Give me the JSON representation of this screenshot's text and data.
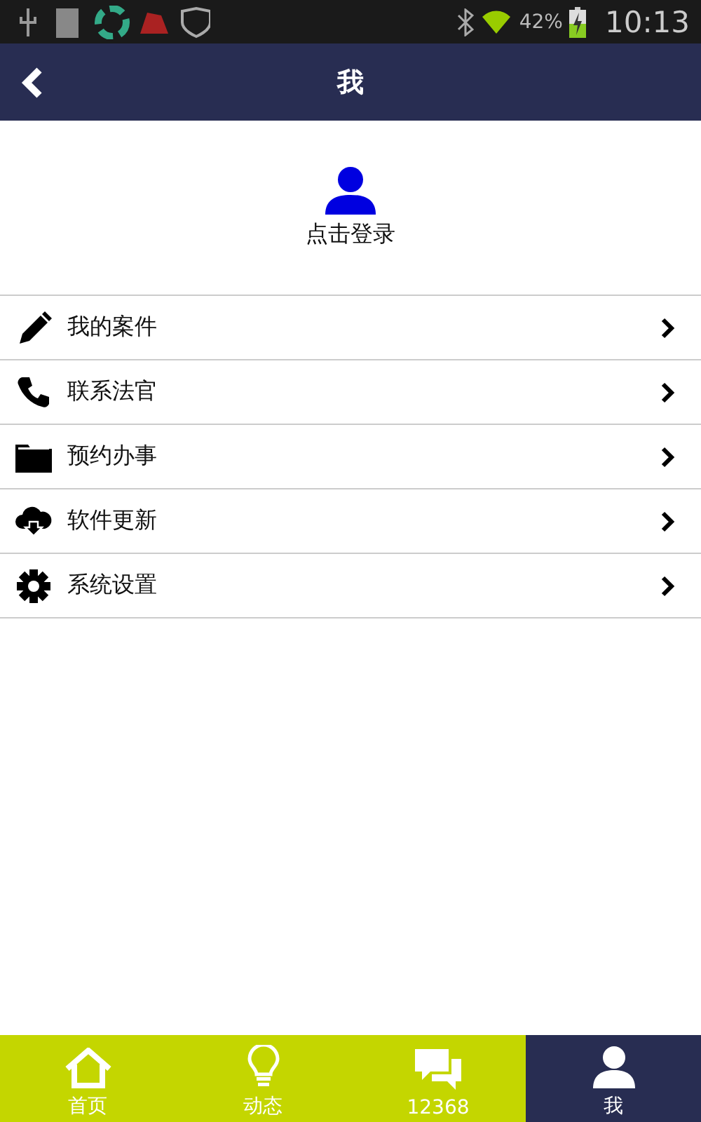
{
  "status_bar": {
    "battery": "42%",
    "time": "10:13"
  },
  "header": {
    "title": "我"
  },
  "profile": {
    "login": "点击登录"
  },
  "menu": [
    {
      "kind": "pencil",
      "label": "我的案件"
    },
    {
      "kind": "phone",
      "label": "联系法官"
    },
    {
      "kind": "folder",
      "label": "预约办事"
    },
    {
      "kind": "cloud",
      "label": "软件更新"
    },
    {
      "kind": "gear",
      "label": "系统设置"
    }
  ],
  "tabs": [
    {
      "kind": "home",
      "label": "首页",
      "selected": false
    },
    {
      "kind": "bulb",
      "label": "动态",
      "selected": false
    },
    {
      "kind": "chat",
      "label": "12368",
      "selected": false
    },
    {
      "kind": "person",
      "label": "我",
      "selected": true
    }
  ]
}
